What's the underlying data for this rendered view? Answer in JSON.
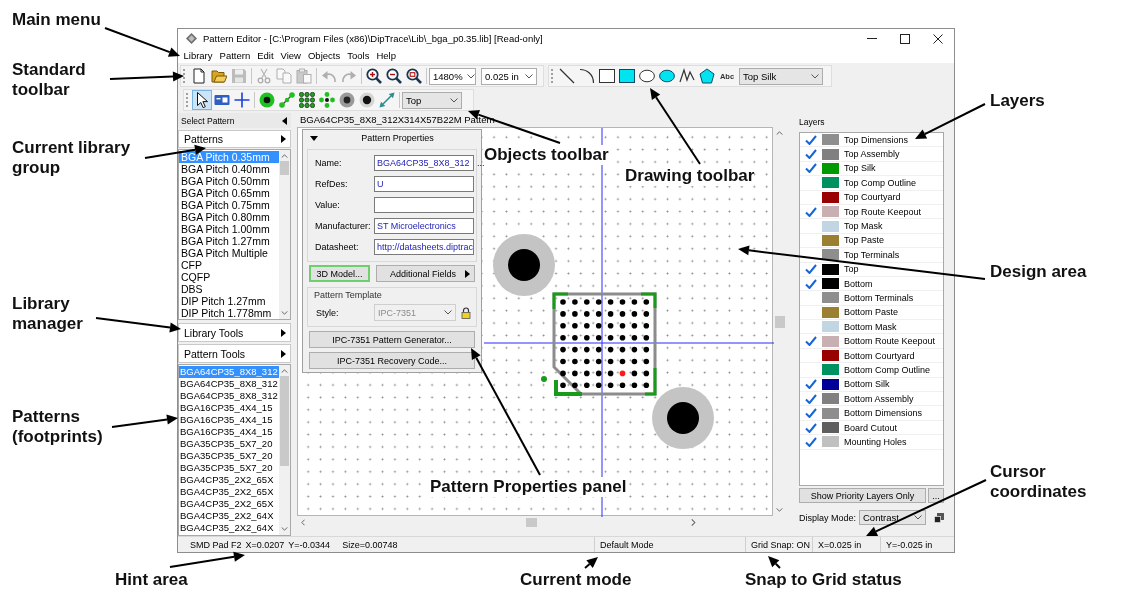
{
  "window": {
    "title": "Pattern Editor - [C:\\Program Files (x86)\\DipTrace\\Lib\\_bga_p0.35.lib] [Read-only]"
  },
  "menu": [
    "Library",
    "Pattern",
    "Edit",
    "View",
    "Objects",
    "Tools",
    "Help"
  ],
  "standard_toolbar": {
    "groups": [
      [
        {
          "kind": "new",
          "disabled": false
        },
        {
          "kind": "open",
          "disabled": false
        },
        {
          "kind": "save",
          "disabled": true
        }
      ],
      [
        {
          "kind": "cut",
          "disabled": true
        },
        {
          "kind": "copy",
          "disabled": true
        },
        {
          "kind": "paste",
          "disabled": true
        }
      ],
      [
        {
          "kind": "undo",
          "disabled": true
        },
        {
          "kind": "redo",
          "disabled": true
        }
      ],
      [
        {
          "kind": "zoom_in",
          "disabled": false
        },
        {
          "kind": "zoom_out",
          "disabled": false
        },
        {
          "kind": "zoom_fit",
          "disabled": false
        }
      ]
    ],
    "zoom": "1480%",
    "grid": "0.025 in"
  },
  "drawing_toolbar": {
    "tools": [
      {
        "kind": "line"
      },
      {
        "kind": "arc"
      },
      {
        "kind": "rectangle"
      },
      {
        "kind": "filled_rectangle"
      },
      {
        "kind": "ellipse"
      },
      {
        "kind": "filled_ellipse"
      },
      {
        "kind": "polyline"
      },
      {
        "kind": "polygon"
      }
    ],
    "text_tool": "Abc",
    "layer": "Top Silk"
  },
  "objects_toolbar": {
    "groups": [
      [
        {
          "kind": "select",
          "selected": true
        },
        {
          "kind": "card",
          "selected": false
        },
        {
          "kind": "origin",
          "selected": false
        }
      ],
      [
        {
          "kind": "pad",
          "selected": false
        },
        {
          "kind": "pad_row",
          "selected": false
        },
        {
          "kind": "pad_array",
          "selected": false
        },
        {
          "kind": "pad_ring",
          "selected": false
        },
        {
          "kind": "hole",
          "selected": false
        },
        {
          "kind": "dot",
          "selected": false
        },
        {
          "kind": "dimension",
          "selected": false
        }
      ]
    ],
    "side": "Top"
  },
  "select_pattern": {
    "title": "Select Pattern",
    "group_button": "Patterns",
    "groups": [
      {
        "label": "BGA Pitch 0.35mm",
        "selected": true
      },
      {
        "label": "BGA Pitch 0.40mm",
        "selected": false
      },
      {
        "label": "BGA Pitch 0.50mm",
        "selected": false
      },
      {
        "label": "BGA Pitch 0.65mm",
        "selected": false
      },
      {
        "label": "BGA Pitch 0.75mm",
        "selected": false
      },
      {
        "label": "BGA Pitch 0.80mm",
        "selected": false
      },
      {
        "label": "BGA Pitch 1.00mm",
        "selected": false
      },
      {
        "label": "BGA Pitch 1.27mm",
        "selected": false
      },
      {
        "label": "BGA Pitch Multiple",
        "selected": false
      },
      {
        "label": "CFP",
        "selected": false
      },
      {
        "label": "CQFP",
        "selected": false
      },
      {
        "label": "DBS",
        "selected": false
      },
      {
        "label": "DIP Pitch 1.27mm",
        "selected": false
      },
      {
        "label": "DIP Pitch 1.778mm",
        "selected": false
      }
    ],
    "library_tools": "Library Tools",
    "pattern_tools": "Pattern Tools",
    "patterns": [
      {
        "label": "BGA64CP35_8X8_312",
        "selected": true
      },
      {
        "label": "BGA64CP35_8X8_312",
        "selected": false
      },
      {
        "label": "BGA64CP35_8X8_312",
        "selected": false
      },
      {
        "label": "BGA16CP35_4X4_15",
        "selected": false
      },
      {
        "label": "BGA16CP35_4X4_15",
        "selected": false
      },
      {
        "label": "BGA16CP35_4X4_15",
        "selected": false
      },
      {
        "label": "BGA35CP35_5X7_20",
        "selected": false
      },
      {
        "label": "BGA35CP35_5X7_20",
        "selected": false
      },
      {
        "label": "BGA35CP35_5X7_20",
        "selected": false
      },
      {
        "label": "BGA4CP35_2X2_65X",
        "selected": false
      },
      {
        "label": "BGA4CP35_2X2_65X",
        "selected": false
      },
      {
        "label": "BGA4CP35_2X2_65X",
        "selected": false
      },
      {
        "label": "BGA4CP35_2X2_64X",
        "selected": false
      },
      {
        "label": "BGA4CP35_2X2_64X",
        "selected": false
      }
    ]
  },
  "design_area": {
    "title": "BGA64CP35_8X8_312X314X57B22M Pattern"
  },
  "pattern_properties": {
    "title": "Pattern Properties",
    "fields": [
      {
        "label": "Name:",
        "value": "BGA64CP35_8X8_312",
        "more": "..."
      },
      {
        "label": "RefDes:",
        "value": "U"
      },
      {
        "label": "Value:"
      },
      {
        "label": "Manufacturer:",
        "value": "ST Microelectronics"
      },
      {
        "label": "Datasheet:",
        "value": "http://datasheets.diptrac"
      }
    ],
    "model_button": {
      "label": "3D Model...",
      "highlighted": true
    },
    "additional_fields": "Additional Fields",
    "template": {
      "title": "Pattern Template",
      "style_label": "Style:",
      "style": "IPC-7351",
      "disabled": true
    },
    "generator_button": "IPC-7351 Pattern Generator...",
    "recovery_button": "IPC-7351 Recovery Code..."
  },
  "layers": {
    "title": "Layers",
    "items": [
      {
        "name": "Top Dimensions",
        "visible": true,
        "color": "#8e8e8e"
      },
      {
        "name": "Top Assembly",
        "visible": true,
        "color": "#808080"
      },
      {
        "name": "Top Silk",
        "visible": true,
        "color": "#009900"
      },
      {
        "name": "Top Comp Outline",
        "visible": false,
        "color": "#009160"
      },
      {
        "name": "Top Courtyard",
        "visible": false,
        "color": "#990000"
      },
      {
        "name": "Top Route Keepout",
        "visible": true,
        "color": "#c8b0b2"
      },
      {
        "name": "Top Mask",
        "visible": false,
        "color": "#c2d5e2"
      },
      {
        "name": "Top Paste",
        "visible": false,
        "color": "#9a8030"
      },
      {
        "name": "Top Terminals",
        "visible": false,
        "color": "#8e8e8e"
      },
      {
        "name": "Top",
        "visible": true,
        "color": "#000000"
      },
      {
        "name": "Bottom",
        "visible": true,
        "color": "#000000"
      },
      {
        "name": "Bottom Terminals",
        "visible": false,
        "color": "#8e8e8e"
      },
      {
        "name": "Bottom Paste",
        "visible": false,
        "color": "#9a8030"
      },
      {
        "name": "Bottom Mask",
        "visible": false,
        "color": "#c2d5e2"
      },
      {
        "name": "Bottom Route Keepout",
        "visible": true,
        "color": "#c8b0b2"
      },
      {
        "name": "Bottom Courtyard",
        "visible": false,
        "color": "#990000"
      },
      {
        "name": "Bottom Comp Outline",
        "visible": false,
        "color": "#009160"
      },
      {
        "name": "Bottom Silk",
        "visible": true,
        "color": "#000099"
      },
      {
        "name": "Bottom Assembly",
        "visible": true,
        "color": "#808080"
      },
      {
        "name": "Bottom Dimensions",
        "visible": true,
        "color": "#8e8e8e"
      },
      {
        "name": "Board Cutout",
        "visible": true,
        "color": "#5e5e5e"
      },
      {
        "name": "Mounting Holes",
        "visible": true,
        "color": "#c0c0c0"
      }
    ],
    "priority_button": "Show Priority Layers Only",
    "more_button": "...",
    "display_mode_label": "Display Mode:",
    "display_mode": "Contrast"
  },
  "status_bar": {
    "hint": [
      "SMD Pad F2",
      "X=0.0207",
      "Y=-0.0344"
    ],
    "size": "Size=0.00748",
    "mode": "Default Mode",
    "grid_snap": "Grid Snap: ON",
    "cursor": [
      "X=0.025 in",
      "Y=-0.025 in"
    ]
  },
  "annotations": [
    {
      "text": "Main menu"
    },
    {
      "text": "Standard toolbar"
    },
    {
      "text": "Layers"
    },
    {
      "text": "Current library group"
    },
    {
      "text": "Objects toolbar"
    },
    {
      "text": "Drawing toolbar"
    },
    {
      "text": "Design area"
    },
    {
      "text": "Library manager"
    },
    {
      "text": "Patterns (footprints)"
    },
    {
      "text": "Pattern Properties panel"
    },
    {
      "text": "Cursor coordinates"
    },
    {
      "text": "Hint area"
    },
    {
      "text": "Current mode"
    },
    {
      "text": "Snap to Grid status"
    }
  ]
}
